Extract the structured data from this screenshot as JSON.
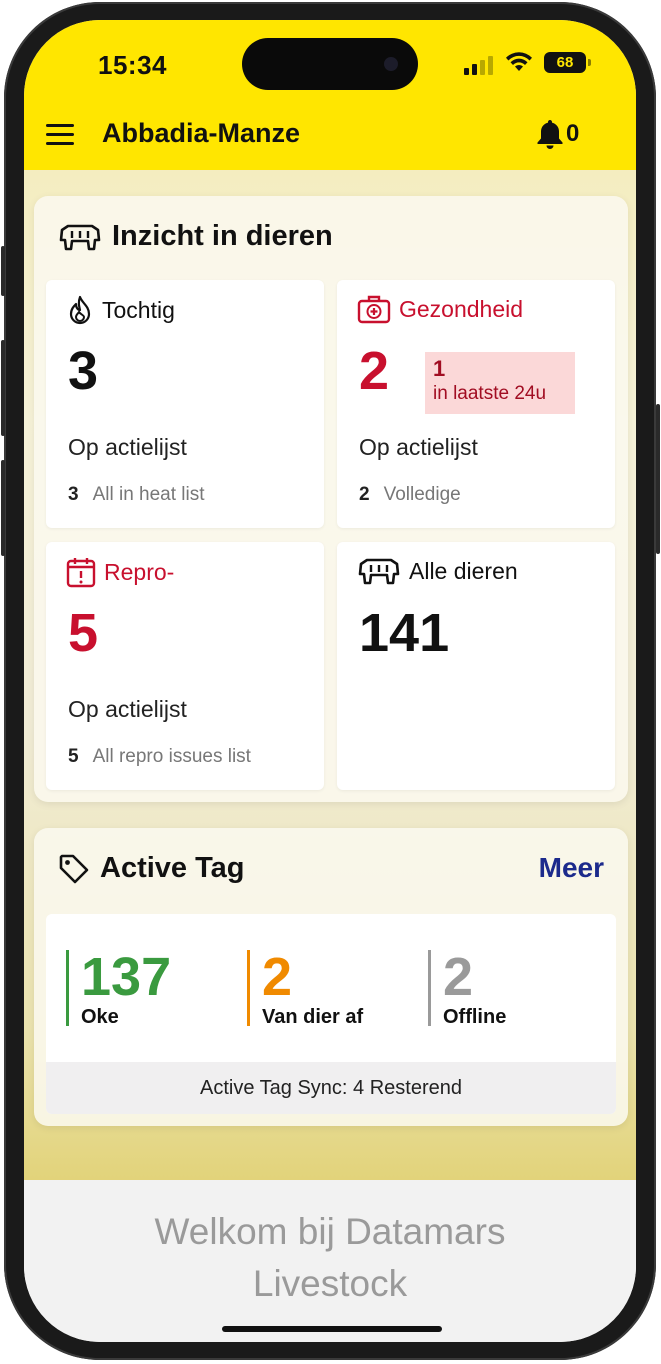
{
  "status_bar": {
    "time": "15:34",
    "battery": "68"
  },
  "header": {
    "title": "Abbadia-Manze",
    "notification_count": "0"
  },
  "animals_panel": {
    "title": "Inzicht in dieren",
    "cards": {
      "tochtig": {
        "title": "Tochtig",
        "count": "3",
        "subtitle": "Op actielijst",
        "footer_count": "3",
        "footer_label": "All in heat list"
      },
      "gezondheid": {
        "title": "Gezondheid",
        "count": "2",
        "badge_count": "1",
        "badge_label": "in laatste 24u",
        "subtitle": "Op actielijst",
        "footer_count": "2",
        "footer_label": "Volledige"
      },
      "repro": {
        "title": "Repro-",
        "count": "5",
        "subtitle": "Op actielijst",
        "footer_count": "5",
        "footer_label": "All repro issues list"
      },
      "alle_dieren": {
        "title": "Alle dieren",
        "count": "141"
      }
    }
  },
  "active_tag_panel": {
    "title": "Active Tag",
    "more_label": "Meer",
    "stats": [
      {
        "value": "137",
        "label": "Oke",
        "color": "#3a9a3f"
      },
      {
        "value": "2",
        "label": "Van dier af",
        "color": "#f08a00"
      },
      {
        "value": "2",
        "label": "Offline",
        "color": "#9a9a9a"
      }
    ],
    "sync_text": "Active Tag Sync: 4 Resterend"
  },
  "welcome": {
    "line1": "Welkom bij Datamars",
    "line2": "Livestock"
  },
  "colors": {
    "brand_yellow": "#ffe600",
    "alert_red": "#c8102e",
    "link_blue": "#1c2a8c"
  }
}
